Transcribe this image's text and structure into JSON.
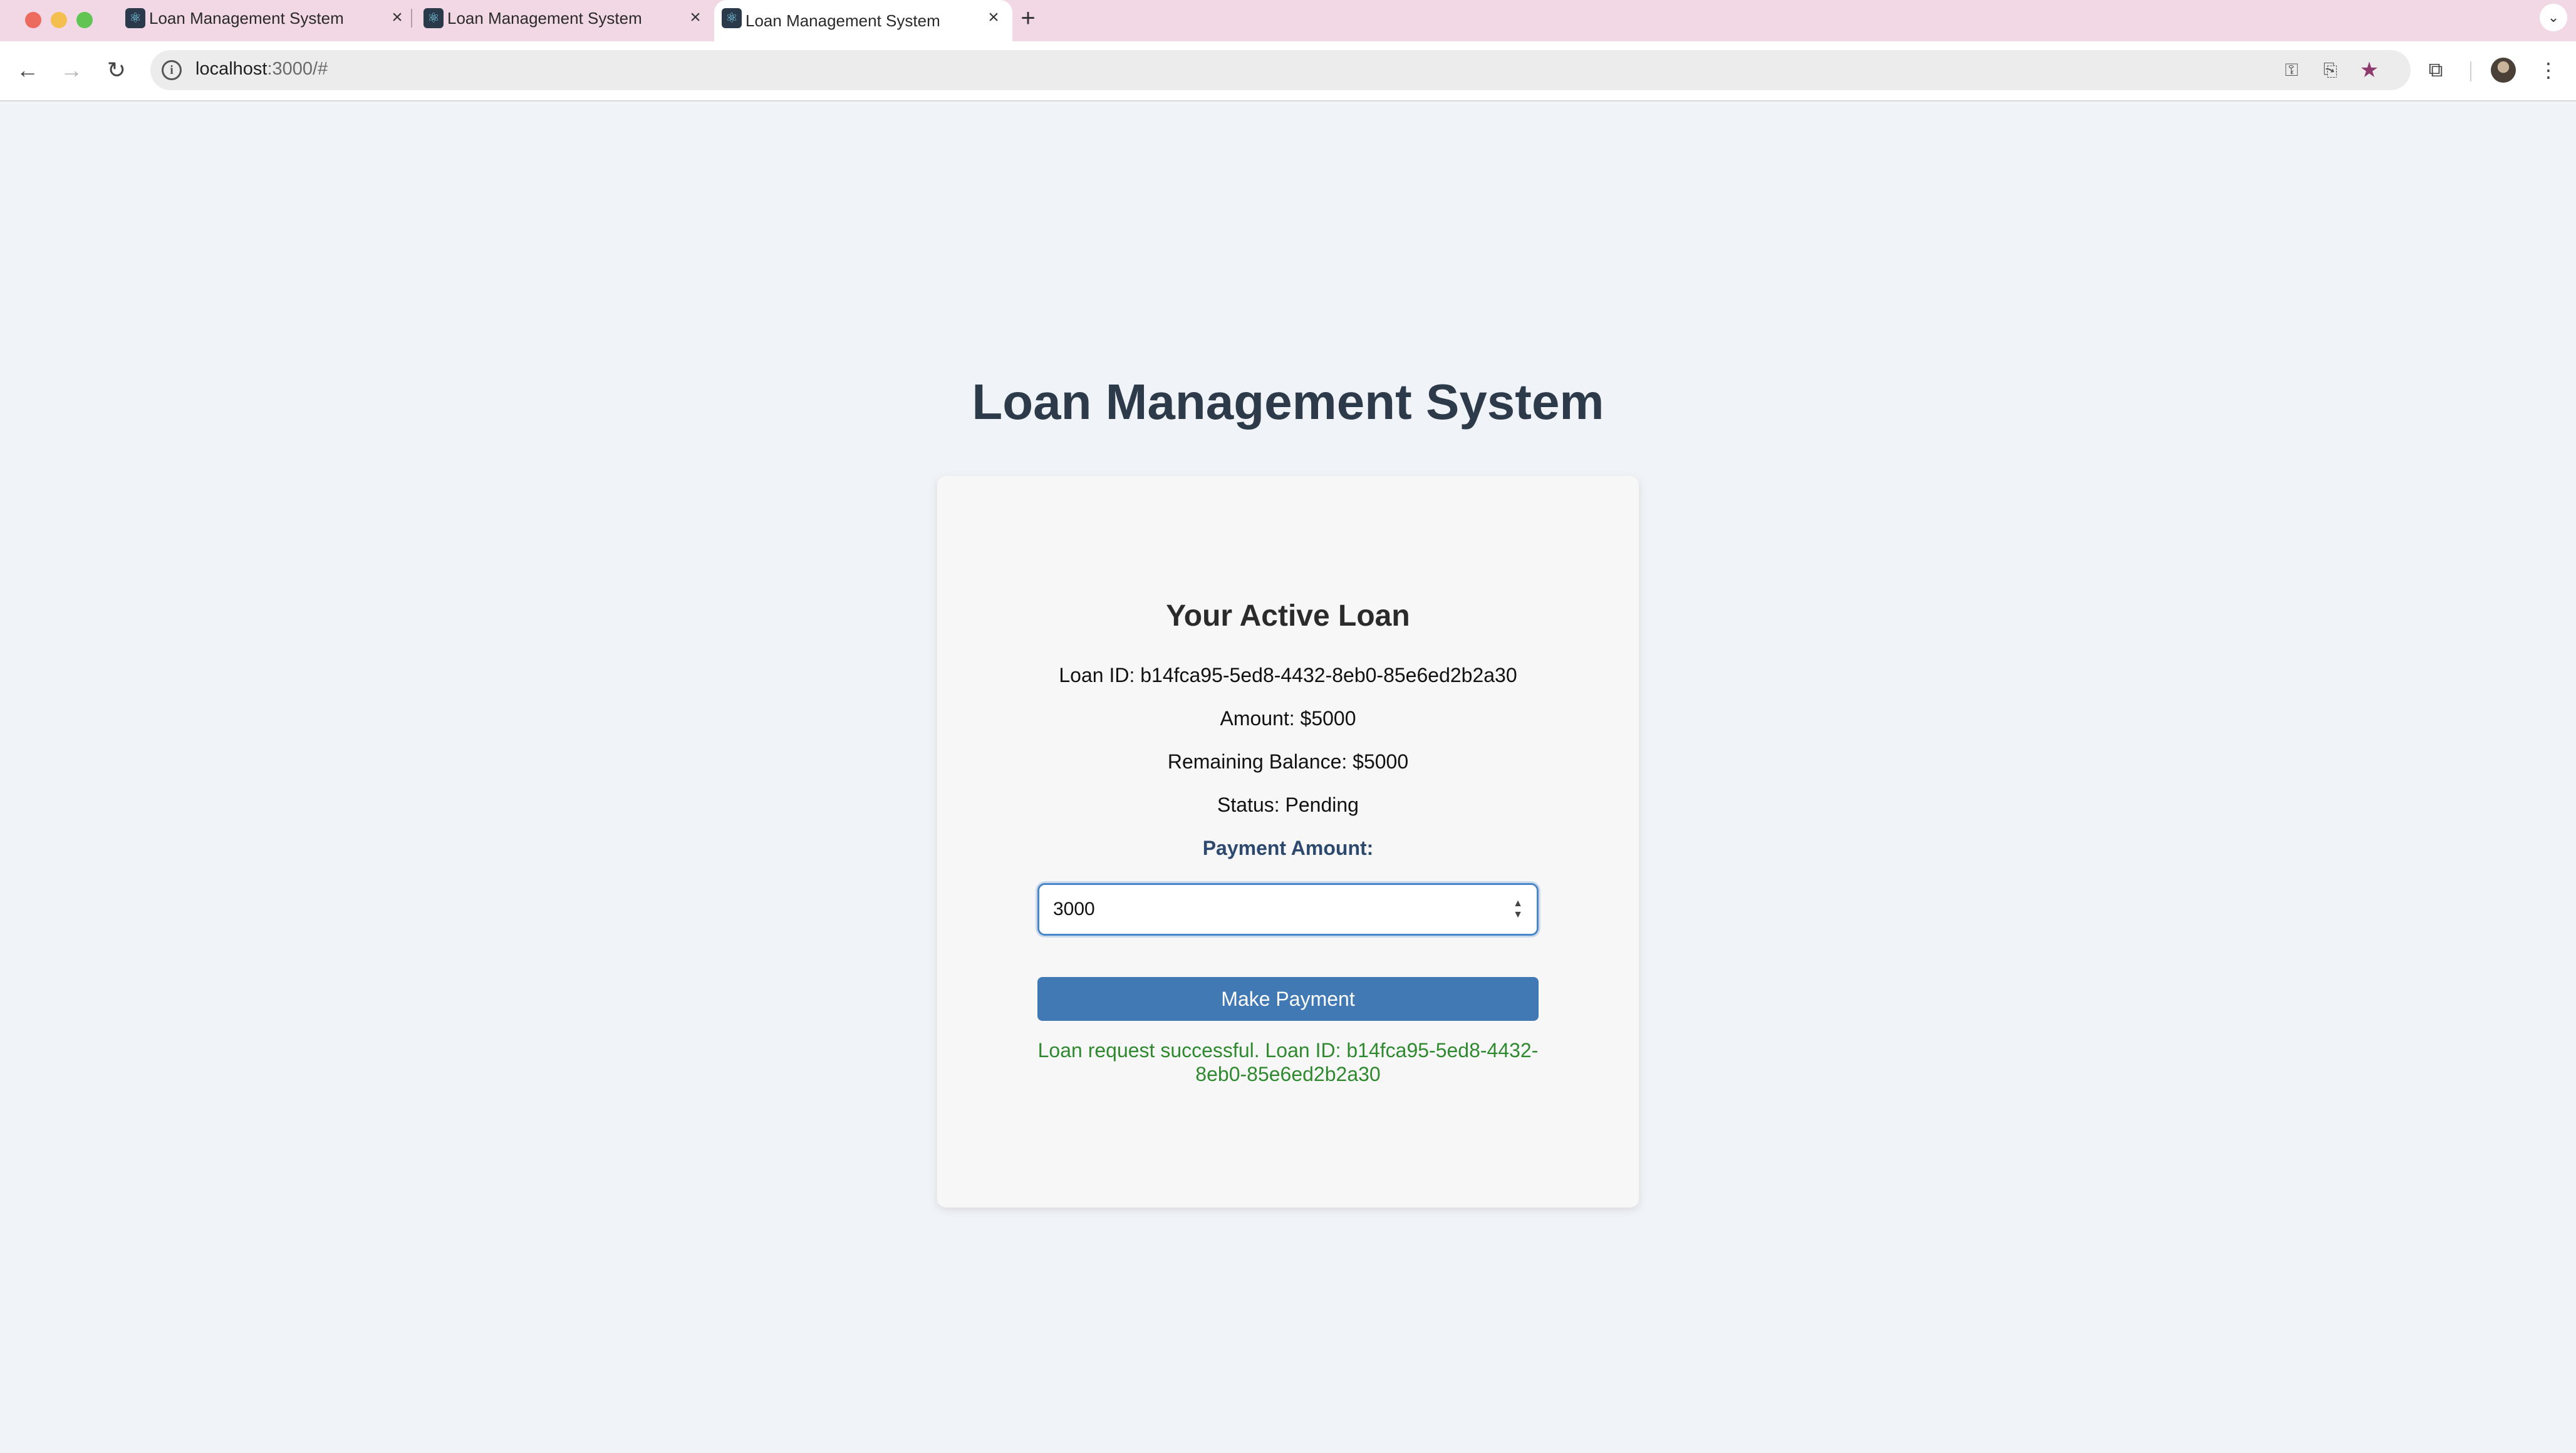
{
  "browser": {
    "tabs": [
      {
        "title": "Loan Management System",
        "active": false
      },
      {
        "title": "Loan Management System",
        "active": false
      },
      {
        "title": "Loan Management System",
        "active": true
      }
    ],
    "tab_close_glyph": "×",
    "new_tab_glyph": "+",
    "url_host": "localhost",
    "url_path": ":3000/#",
    "icons": [
      "back-arrow-icon",
      "forward-arrow-icon",
      "reload-icon",
      "site-info-icon",
      "password-key-icon",
      "install-app-icon",
      "bookmark-star-icon",
      "extensions-icon",
      "profile-avatar",
      "more-menu-icon",
      "tab-list-icon"
    ]
  },
  "page": {
    "title": "Loan Management System",
    "card": {
      "heading": "Your Active Loan",
      "loan_id_line": "Loan ID: b14fca95-5ed8-4432-8eb0-85e6ed2b2a30",
      "amount_line": "Amount: $5000",
      "balance_line": "Remaining Balance: $5000",
      "status_line": "Status: Pending",
      "payment_label": "Payment Amount:",
      "payment_value": "3000",
      "button_label": "Make Payment",
      "message": "Loan request successful. Loan ID: b14fca95-5ed8-4432-8eb0-85e6ed2b2a30"
    }
  },
  "colors": {
    "page_bg": "#f0f3f8",
    "title": "#2d3a4a",
    "button": "#4079b4",
    "success": "#2f8a2f",
    "input_focus": "#4a86c8"
  }
}
